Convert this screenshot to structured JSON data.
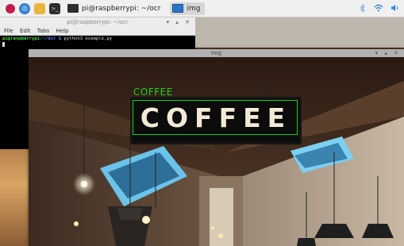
{
  "taskbar": {
    "tasks": [
      {
        "label": "pi@raspberrypi: ~/ocr",
        "active": false
      },
      {
        "label": "img",
        "active": true
      }
    ],
    "tray": [
      "bluetooth-icon",
      "wifi-icon",
      "volume-icon"
    ]
  },
  "terminal": {
    "title": "pi@raspberrypi: ~/ocr",
    "menu": [
      "File",
      "Edit",
      "Tabs",
      "Help"
    ],
    "prompt_user": "pi@raspberrypi",
    "prompt_path": ":~/ocr $",
    "command": "python3 example.py",
    "controls": "▾ ▴ ✕"
  },
  "image_window": {
    "title": "img",
    "controls": "▾ ▴ ✕",
    "ocr_result": "COFFEE",
    "sign_text": "COFFEE"
  },
  "colors": {
    "ocr_box": "#17d317",
    "prompt": "#4ce24c",
    "path": "#5b8cff"
  }
}
